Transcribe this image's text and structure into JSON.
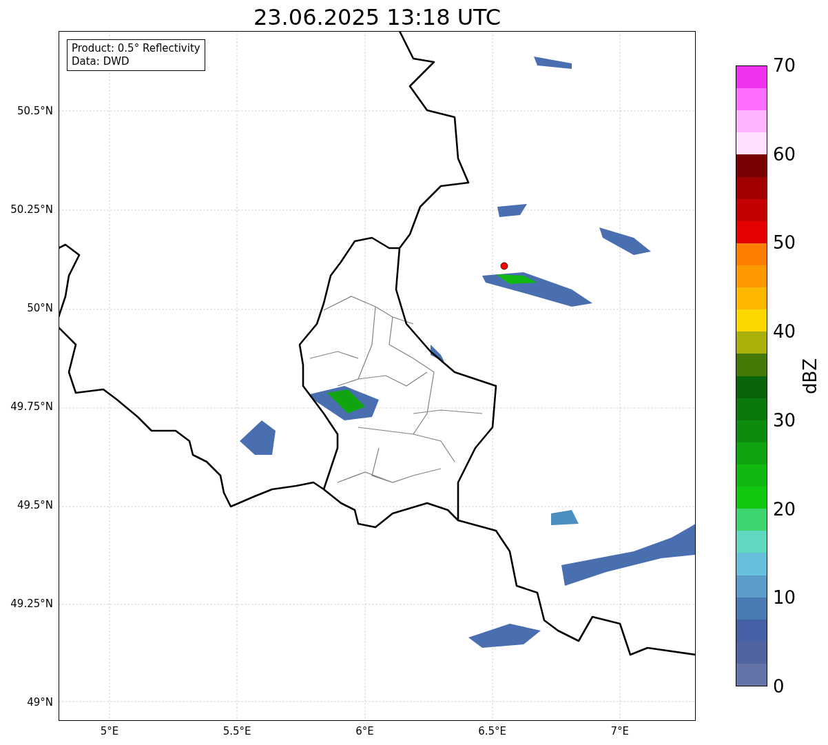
{
  "title": "23.06.2025 13:18 UTC",
  "info_box": {
    "lines": [
      "Product: 0.5° Reflectivity",
      "Data: DWD"
    ]
  },
  "y_ticks": [
    "50.5°N",
    "50.25°N",
    "50°N",
    "49.75°N",
    "49.5°N",
    "49.25°N",
    "49°N"
  ],
  "x_ticks": [
    "5°E",
    "5.5°E",
    "6°E",
    "6.5°E",
    "7°E"
  ],
  "colorbar": {
    "label": "dBZ",
    "ticks": [
      "70",
      "60",
      "50",
      "40",
      "30",
      "20",
      "10",
      "0"
    ],
    "segments": [
      {
        "color": "#ee33ee"
      },
      {
        "color": "#ff6eff"
      },
      {
        "color": "#ffb4ff"
      },
      {
        "color": "#ffe0ff"
      },
      {
        "color": "#780000"
      },
      {
        "color": "#a00000"
      },
      {
        "color": "#c40000"
      },
      {
        "color": "#e40000"
      },
      {
        "color": "#ff7d00"
      },
      {
        "color": "#ff9900"
      },
      {
        "color": "#ffb800"
      },
      {
        "color": "#ffd700"
      },
      {
        "color": "#aab00a"
      },
      {
        "color": "#467808"
      },
      {
        "color": "#086408"
      },
      {
        "color": "#0a780a"
      },
      {
        "color": "#0c8c0c"
      },
      {
        "color": "#10a410"
      },
      {
        "color": "#10b810"
      },
      {
        "color": "#10c810"
      },
      {
        "color": "#3ed46e"
      },
      {
        "color": "#60d8c0"
      },
      {
        "color": "#66c0dc"
      },
      {
        "color": "#5a9cc8"
      },
      {
        "color": "#4a7ab4"
      },
      {
        "color": "#4460a6"
      },
      {
        "color": "#5065a0"
      },
      {
        "color": "#6474a8"
      }
    ]
  }
}
